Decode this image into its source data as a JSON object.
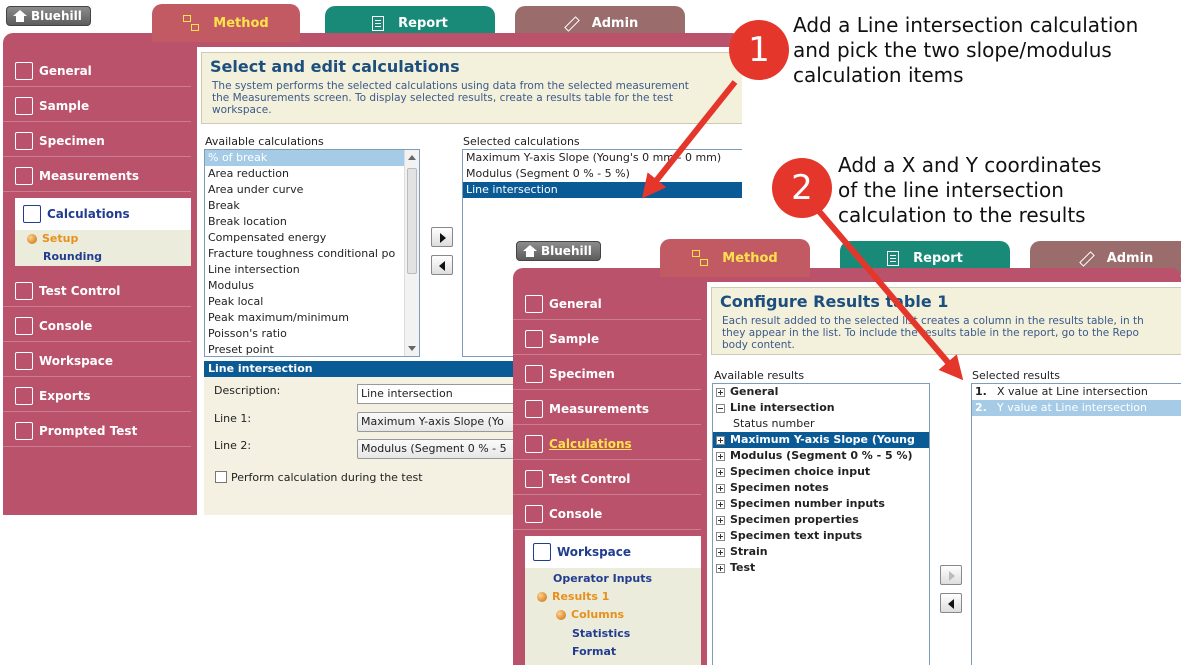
{
  "annotations": [
    {
      "number": "1",
      "text": [
        "Add a Line intersection calculation",
        "and pick the two slope/modulus",
        "calculation items"
      ]
    },
    {
      "number": "2",
      "text": [
        "Add a X and Y coordinates",
        "of the line intersection",
        "calculation to the results"
      ]
    }
  ],
  "colors": {
    "frame": "#b9526a",
    "method_tab": "#c25a63",
    "report_tab": "#1a8a78",
    "admin_tab": "#9a6c6c",
    "selection": "#0a5a96",
    "callout": "#e5362c"
  },
  "win1": {
    "home_label": "Bluehill",
    "tabs": [
      {
        "label": "Method",
        "icon": "flowchart-icon"
      },
      {
        "label": "Report",
        "icon": "document-icon"
      },
      {
        "label": "Admin",
        "icon": "pencil-icon"
      }
    ],
    "nav": [
      "General",
      "Sample",
      "Specimen",
      "Measurements",
      "Calculations",
      "Test Control",
      "Console",
      "Workspace",
      "Exports",
      "Prompted Test"
    ],
    "subnav": {
      "setup": "Setup",
      "rounding": "Rounding"
    },
    "title": "Select and edit calculations",
    "desc1": "The system performs the selected calculations using data from the selected measurement",
    "desc2": "the Measurements screen. To display selected results, create a results table for the test",
    "desc3": "workspace.",
    "available_label": "Available calculations",
    "available": [
      "% of break",
      "Area reduction",
      "Area under curve",
      "Break",
      "Break location",
      "Compensated energy",
      "Fracture toughness conditional po",
      "Line intersection",
      "Modulus",
      "Peak local",
      "Peak maximum/minimum",
      "Poisson's ratio",
      "Preset point"
    ],
    "selected_label": "Selected calculations",
    "selected": [
      "Maximum Y-axis Slope (Young's 0 mm - 0 mm)",
      "Modulus (Segment 0 % - 5 %)",
      "Line intersection"
    ],
    "section_title": "Line intersection",
    "description_label": "Description:",
    "description_value": "Line intersection",
    "line1_label": "Line 1:",
    "line1_value": "Maximum Y-axis Slope (Yo",
    "line2_label": "Line 2:",
    "line2_value": "Modulus (Segment 0 % - 5",
    "perform_label": "Perform calculation during the test"
  },
  "win2": {
    "home_label": "Bluehill",
    "tabs": [
      {
        "label": "Method",
        "icon": "flowchart-icon"
      },
      {
        "label": "Report",
        "icon": "document-icon"
      },
      {
        "label": "Admin",
        "icon": "pencil-icon"
      }
    ],
    "nav": [
      "General",
      "Sample",
      "Specimen",
      "Measurements",
      "Calculations",
      "Test Control",
      "Console",
      "Workspace"
    ],
    "subnav": {
      "operator_inputs": "Operator Inputs",
      "results1": "Results 1",
      "columns": "Columns",
      "statistics": "Statistics",
      "format": "Format"
    },
    "title": "Configure Results table 1",
    "desc1": "Each result added to the selected list creates a column in the results table, in th",
    "desc2": "they appear in the list. To include the results table in the report, go to the Repo",
    "desc3": "body content.",
    "available_label": "Available results",
    "tree": [
      {
        "label": "General",
        "kind": "plus"
      },
      {
        "label": "Line intersection",
        "kind": "minus"
      },
      {
        "label": "Status number",
        "kind": "child"
      },
      {
        "label": "Maximum Y-axis Slope (Young",
        "kind": "plus"
      },
      {
        "label": "Modulus (Segment 0 % - 5 %)",
        "kind": "plus"
      },
      {
        "label": "Specimen choice input",
        "kind": "plus"
      },
      {
        "label": "Specimen notes",
        "kind": "plus"
      },
      {
        "label": "Specimen number inputs",
        "kind": "plus"
      },
      {
        "label": "Specimen properties",
        "kind": "plus"
      },
      {
        "label": "Specimen text inputs",
        "kind": "plus"
      },
      {
        "label": "Strain",
        "kind": "plus"
      },
      {
        "label": "Test",
        "kind": "plus"
      }
    ],
    "selected_label": "Selected results",
    "selected": [
      {
        "num": "1.",
        "label": "X value at Line intersection"
      },
      {
        "num": "2.",
        "label": "Y value at Line intersection"
      }
    ]
  }
}
